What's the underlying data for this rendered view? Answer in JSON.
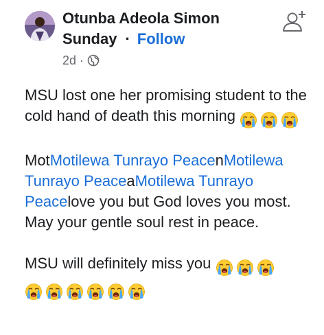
{
  "header": {
    "author_line1": "Otunba Adeola Simon",
    "author_line2": "Sunday",
    "separator": "·",
    "follow_label": "Follow",
    "time": "2d",
    "meta_separator": "·",
    "privacy_icon": "globe-icon",
    "add_friend_icon": "add-friend-icon"
  },
  "post": {
    "line1": "MSU lost one her promising student to the cold hand of death this morning",
    "tag_para": {
      "t1": "Mot",
      "tag1": "Motilewa Tunrayo Peace",
      "t2": "n",
      "tag2": "Motilewa Tunrayo Peace",
      "t3": "a",
      "tag3": "Motilewa Tunrayo Peace",
      "t4": "love you but God loves you most."
    },
    "line3": "May your gentle soul rest in peace.",
    "line4": "MSU will definitely miss you",
    "emoji_name": "loudly-crying-face-icon"
  },
  "colors": {
    "link": "#1a6ed8",
    "text": "#1c1e21",
    "meta": "#65676b"
  }
}
